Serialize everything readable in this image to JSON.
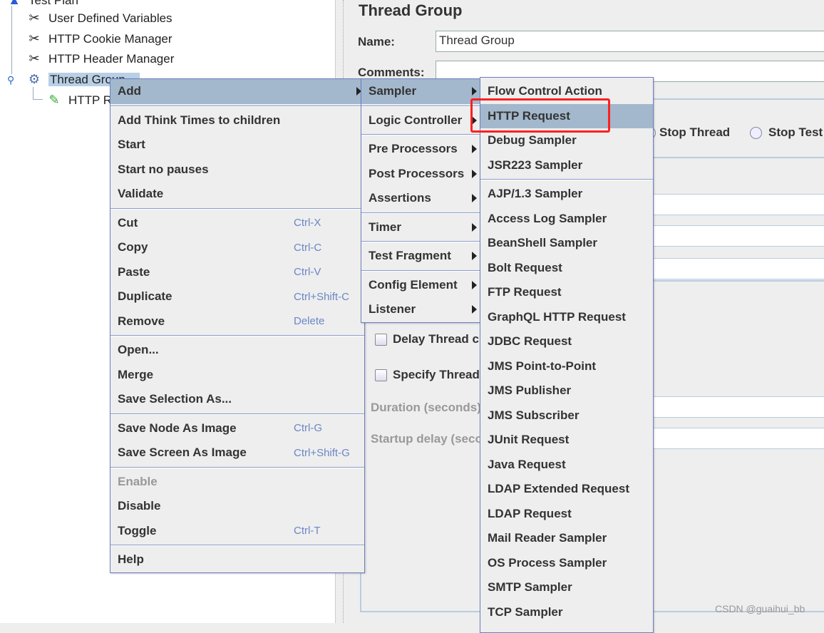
{
  "tree": {
    "items": [
      {
        "label": "Test Plan",
        "icon": "test-plan-icon"
      },
      {
        "label": "User Defined Variables",
        "icon": "config-wrench-icon"
      },
      {
        "label": "HTTP Cookie Manager",
        "icon": "config-wrench-icon"
      },
      {
        "label": "HTTP Header Manager",
        "icon": "config-wrench-icon"
      },
      {
        "label": "Thread Group",
        "icon": "gear-icon"
      },
      {
        "label": "HTTP Request",
        "icon": "pipette-sampler-icon"
      }
    ]
  },
  "panel": {
    "title": "Thread Group",
    "name_label": "Name:",
    "name_value": "Thread Group",
    "comments_label": "Comments:",
    "comments_value": "",
    "stop_thread": "Stop Thread",
    "stop_test": "Stop Test",
    "delay_thread": "Delay Thread creation until needed",
    "specify_thread": "Specify Thread lifetime",
    "duration": "Duration (seconds)",
    "startup_delay": "Startup delay (seconds)"
  },
  "context_menu": {
    "groups": [
      [
        {
          "label": "Add",
          "submenu": true,
          "highlighted": true
        }
      ],
      [
        {
          "label": "Add Think Times to children"
        },
        {
          "label": "Start"
        },
        {
          "label": "Start no pauses"
        },
        {
          "label": "Validate"
        }
      ],
      [
        {
          "label": "Cut",
          "shortcut": "Ctrl-X"
        },
        {
          "label": "Copy",
          "shortcut": "Ctrl-C"
        },
        {
          "label": "Paste",
          "shortcut": "Ctrl-V"
        },
        {
          "label": "Duplicate",
          "shortcut": "Ctrl+Shift-C"
        },
        {
          "label": "Remove",
          "shortcut": "Delete"
        }
      ],
      [
        {
          "label": "Open..."
        },
        {
          "label": "Merge"
        },
        {
          "label": "Save Selection As..."
        }
      ],
      [
        {
          "label": "Save Node As Image",
          "shortcut": "Ctrl-G"
        },
        {
          "label": "Save Screen As Image",
          "shortcut": "Ctrl+Shift-G"
        }
      ],
      [
        {
          "label": "Enable",
          "disabled": true
        },
        {
          "label": "Disable"
        },
        {
          "label": "Toggle",
          "shortcut": "Ctrl-T"
        }
      ],
      [
        {
          "label": "Help"
        }
      ]
    ]
  },
  "add_menu": {
    "groups": [
      [
        {
          "label": "Sampler",
          "submenu": true,
          "highlighted": true
        }
      ],
      [
        {
          "label": "Logic Controller",
          "submenu": true
        }
      ],
      [
        {
          "label": "Pre Processors",
          "submenu": true
        },
        {
          "label": "Post Processors",
          "submenu": true
        },
        {
          "label": "Assertions",
          "submenu": true
        }
      ],
      [
        {
          "label": "Timer",
          "submenu": true
        }
      ],
      [
        {
          "label": "Test Fragment",
          "submenu": true
        }
      ],
      [
        {
          "label": "Config Element",
          "submenu": true
        },
        {
          "label": "Listener",
          "submenu": true
        }
      ]
    ]
  },
  "sampler_menu": {
    "groups": [
      [
        {
          "label": "Flow Control Action"
        },
        {
          "label": "HTTP Request",
          "highlighted": true
        },
        {
          "label": "Debug Sampler"
        },
        {
          "label": "JSR223 Sampler"
        }
      ],
      [
        {
          "label": "AJP/1.3 Sampler"
        },
        {
          "label": "Access Log Sampler"
        },
        {
          "label": "BeanShell Sampler"
        },
        {
          "label": "Bolt Request"
        },
        {
          "label": "FTP Request"
        },
        {
          "label": "GraphQL HTTP Request"
        },
        {
          "label": "JDBC Request"
        },
        {
          "label": "JMS Point-to-Point"
        },
        {
          "label": "JMS Publisher"
        },
        {
          "label": "JMS Subscriber"
        },
        {
          "label": "JUnit Request"
        },
        {
          "label": "Java Request"
        },
        {
          "label": "LDAP Extended Request"
        },
        {
          "label": "LDAP Request"
        },
        {
          "label": "Mail Reader Sampler"
        },
        {
          "label": "OS Process Sampler"
        },
        {
          "label": "SMTP Sampler"
        },
        {
          "label": "TCP Sampler"
        }
      ]
    ]
  },
  "watermark": "CSDN @guaihui_bb",
  "colors": {
    "highlight": "#a3b8cc",
    "annotation_box": "#ff2020",
    "shortcut": "#6b86c6"
  }
}
